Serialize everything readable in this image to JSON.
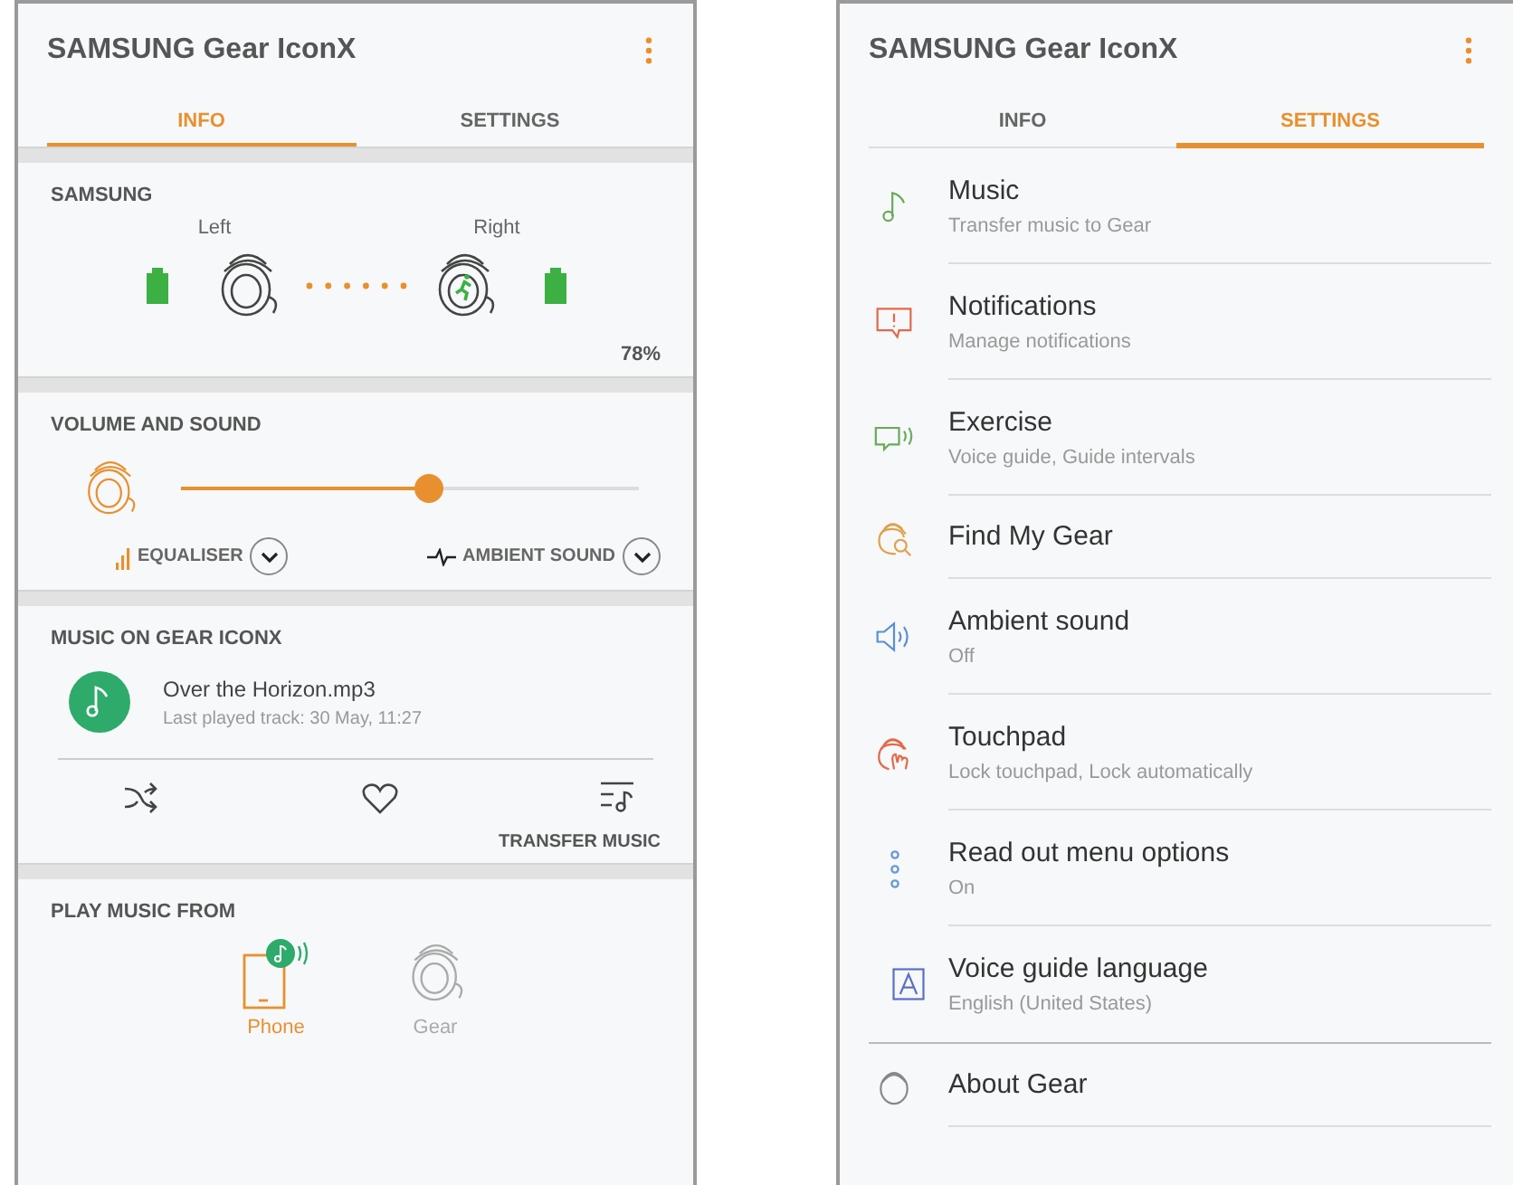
{
  "info_screen": {
    "title": "SAMSUNG Gear IconX",
    "tabs": [
      {
        "label": "INFO",
        "selected": true
      },
      {
        "label": "SETTINGS",
        "selected": false
      }
    ],
    "device": {
      "heading": "SAMSUNG",
      "left_label": "Left",
      "right_label": "Right",
      "battery": "78%"
    },
    "volume": {
      "heading": "VOLUME AND SOUND",
      "level": 0.54,
      "equaliser": "EQUALISER",
      "ambient": "AMBIENT SOUND"
    },
    "music": {
      "heading": "MUSIC ON GEAR ICONX",
      "track": "Over the Horizon.mp3",
      "last_played": "Last played track: 30 May, 11:27",
      "transfer": "TRANSFER MUSIC"
    },
    "play_from": {
      "heading": "PLAY MUSIC FROM",
      "sources": [
        {
          "kind": "phone",
          "label": "Phone",
          "selected": true
        },
        {
          "kind": "gear",
          "label": "Gear",
          "selected": false
        }
      ]
    }
  },
  "settings_screen": {
    "title": "SAMSUNG Gear IconX",
    "tabs": [
      {
        "label": "INFO",
        "selected": false
      },
      {
        "label": "SETTINGS",
        "selected": true
      }
    ],
    "items": [
      {
        "kind": "music",
        "title": "Music",
        "subtitle": "Transfer music to Gear"
      },
      {
        "kind": "notifications",
        "title": "Notifications",
        "subtitle": "Manage notifications"
      },
      {
        "kind": "exercise",
        "title": "Exercise",
        "subtitle": "Voice guide, Guide intervals"
      },
      {
        "kind": "find",
        "title": "Find My Gear"
      },
      {
        "kind": "ambient",
        "title": "Ambient sound",
        "subtitle": "Off"
      },
      {
        "kind": "touchpad",
        "title": "Touchpad",
        "subtitle": "Lock touchpad, Lock automatically"
      },
      {
        "kind": "readout",
        "title": "Read out menu options",
        "subtitle": "On"
      },
      {
        "kind": "language",
        "title": "Voice guide language",
        "subtitle": "English (United States)"
      },
      {
        "kind": "about",
        "title": "About Gear"
      }
    ]
  }
}
